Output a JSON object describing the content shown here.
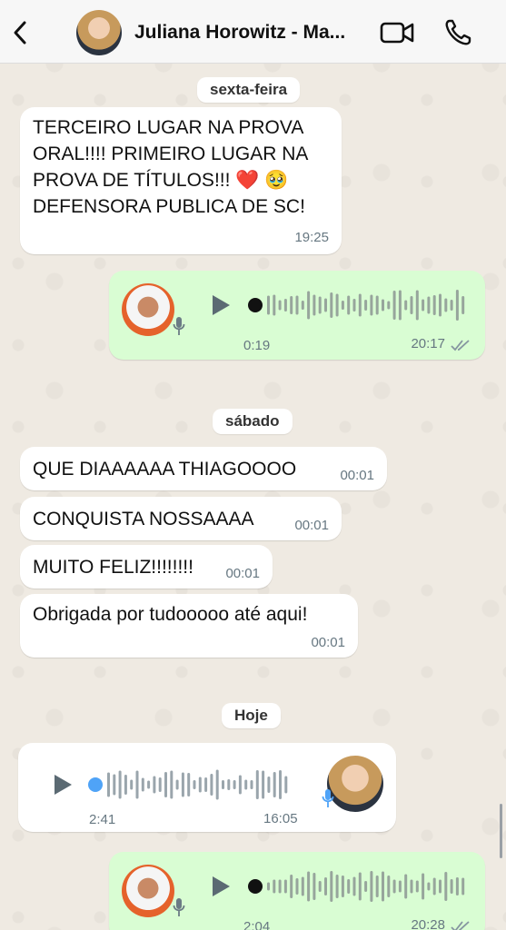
{
  "header": {
    "contact_name": "Juliana Horowitz - Ma...",
    "back_icon": "chevron-left-icon",
    "video_icon": "video-camera-icon",
    "call_icon": "phone-icon"
  },
  "dates": {
    "d1": "sexta-feira",
    "d2": "sábado",
    "d3": "Hoje"
  },
  "messages": {
    "m1": {
      "lines": [
        "TERCEIRO LUGAR NA PROVA",
        "ORAL!!!! PRIMEIRO LUGAR NA",
        "PROVA DE TÍTULOS!!! ❤️ 🥹",
        "DEFENSORA PUBLICA DE SC!"
      ],
      "time": "19:25"
    },
    "v1": {
      "duration": "0:19",
      "time": "20:17"
    },
    "m2": {
      "text": "QUE DIAAAAAA THIAGOOOO",
      "time": "00:01"
    },
    "m3": {
      "text": "CONQUISTA NOSSAAAA",
      "time": "00:01"
    },
    "m4": {
      "text": "MUITO FELIZ!!!!!!!!",
      "time": "00:01"
    },
    "m5": {
      "text": "Obrigada por tudooooo até aqui!",
      "time": "00:01"
    },
    "v2": {
      "duration": "2:41",
      "time": "16:05"
    },
    "v3": {
      "duration": "2:04",
      "time": "20:28"
    }
  },
  "colors": {
    "incoming": "#ffffff",
    "outgoing": "#d9fdd3",
    "accent_blue": "#4fa3f7"
  }
}
